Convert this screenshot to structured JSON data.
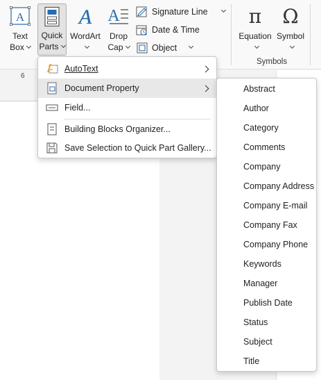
{
  "ribbon": {
    "text_box": {
      "line1": "Text",
      "line2": "Box"
    },
    "quick_parts": {
      "line1": "Quick",
      "line2": "Parts"
    },
    "wordart": {
      "label": "WordArt"
    },
    "drop_cap": {
      "line1": "Drop",
      "line2": "Cap"
    },
    "signature_line": "Signature Line",
    "date_time": "Date & Time",
    "object": "Object",
    "equation": "Equation",
    "symbol": "Symbol",
    "symbols_group": "Symbols"
  },
  "ruler": {
    "mark": "6"
  },
  "quick_parts_menu": {
    "items": [
      {
        "label": "AutoText",
        "icon": "autotext-icon",
        "submenu": true
      },
      {
        "label": "Document Property",
        "icon": "document-property-icon",
        "submenu": true
      },
      {
        "label": "Field...",
        "icon": "field-icon",
        "submenu": false
      },
      {
        "label": "Building Blocks Organizer...",
        "icon": "building-blocks-icon",
        "submenu": false
      },
      {
        "label": "Save Selection to Quick Part Gallery...",
        "icon": "save-selection-icon",
        "submenu": false
      }
    ]
  },
  "document_property_menu": {
    "items": [
      "Abstract",
      "Author",
      "Category",
      "Comments",
      "Company",
      "Company Address",
      "Company E-mail",
      "Company Fax",
      "Company Phone",
      "Keywords",
      "Manager",
      "Publish Date",
      "Status",
      "Subject",
      "Title"
    ]
  },
  "colors": {
    "accent_blue": "#2b6cb0",
    "highlight": "#e8e8e8"
  }
}
